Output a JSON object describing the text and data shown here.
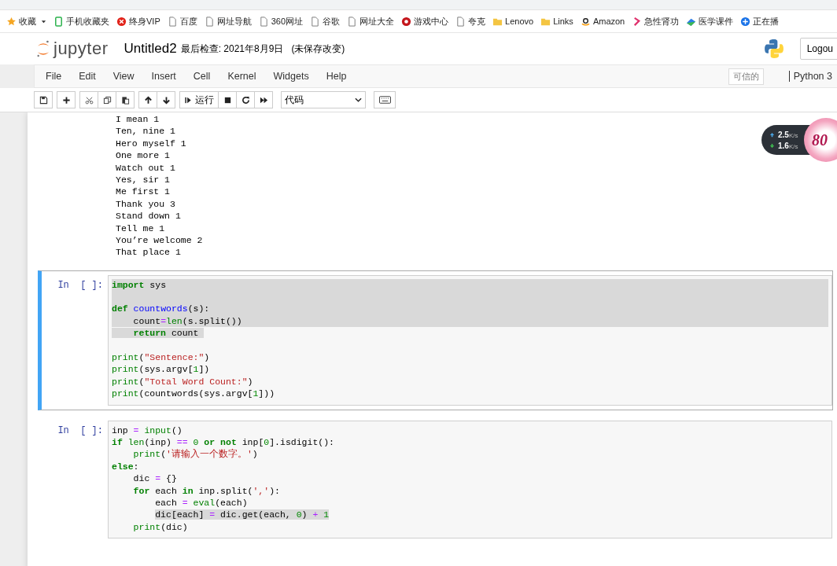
{
  "bookmarks": [
    {
      "kind": "star",
      "label": "收藏",
      "caret": true
    },
    {
      "kind": "phone",
      "label": "手机收藏夹"
    },
    {
      "kind": "vip",
      "label": "终身VIP"
    },
    {
      "kind": "doc",
      "label": "百度"
    },
    {
      "kind": "doc",
      "label": "网址导航"
    },
    {
      "kind": "doc",
      "label": "360网址"
    },
    {
      "kind": "doc",
      "label": "谷歌"
    },
    {
      "kind": "doc",
      "label": "网址大全"
    },
    {
      "kind": "game",
      "label": "游戏中心"
    },
    {
      "kind": "doc",
      "label": "夸克"
    },
    {
      "kind": "folder",
      "label": "Lenovo"
    },
    {
      "kind": "folder",
      "label": "Links"
    },
    {
      "kind": "amazon",
      "label": "Amazon"
    },
    {
      "kind": "ribbon",
      "label": "急性肾功"
    },
    {
      "kind": "book",
      "label": "医学课件"
    },
    {
      "kind": "plus",
      "label": "正在播"
    }
  ],
  "header": {
    "logo": "jupyter",
    "title": "Untitled2",
    "checkpoint": "最后检查: 2021年8月9日",
    "unsaved": "(未保存改变)",
    "logout": "Logou"
  },
  "menu": {
    "items": [
      "File",
      "Edit",
      "View",
      "Insert",
      "Cell",
      "Kernel",
      "Widgets",
      "Help"
    ],
    "trusted": "可信的",
    "kernel": "Python 3"
  },
  "toolbar": {
    "buttons": [
      {
        "kind": "save"
      },
      {
        "kind": "plus"
      },
      {
        "kind": "cut"
      },
      {
        "kind": "copy"
      },
      {
        "kind": "paste"
      },
      {
        "kind": "up"
      },
      {
        "kind": "down"
      },
      {
        "kind": "run",
        "label": "运行"
      },
      {
        "kind": "stop"
      },
      {
        "kind": "restart"
      },
      {
        "kind": "forward"
      }
    ],
    "cell_type": "代码"
  },
  "output": [
    "I mean 1",
    "Ten, nine 1",
    "Hero myself 1",
    "One more 1",
    "Watch out 1",
    "Yes, sir 1",
    "Me first 1",
    "Thank you 3",
    "Stand down 1",
    "Tell me 1",
    "You’re welcome 2",
    "That place 1"
  ],
  "cells": [
    {
      "prompt": "In  [ ]:",
      "selected": true,
      "lines": [
        {
          "kind": "code",
          "selected": true,
          "tokens": [
            {
              "kind": "kw",
              "text": "import"
            },
            {
              "kind": "p",
              "text": " sys"
            }
          ]
        },
        {
          "kind": "blank",
          "selected": true
        },
        {
          "kind": "code",
          "selected": true,
          "tokens": [
            {
              "kind": "kw",
              "text": "def"
            },
            {
              "kind": "fn",
              "text": " countwords"
            },
            {
              "kind": "p",
              "text": "(s):"
            }
          ]
        },
        {
          "kind": "code",
          "selected": true,
          "tokens": [
            {
              "kind": "p",
              "text": "    count"
            },
            {
              "kind": "op",
              "text": "="
            },
            {
              "kind": "bi",
              "text": "len"
            },
            {
              "kind": "p",
              "text": "(s.split())"
            }
          ]
        },
        {
          "kind": "code-mark",
          "selected": false,
          "tokens": [
            {
              "kind": "kw",
              "text": "    return"
            },
            {
              "kind": "p",
              "text": " count "
            }
          ]
        },
        {
          "kind": "blank",
          "selected": false
        },
        {
          "kind": "code",
          "selected": false,
          "tokens": [
            {
              "kind": "bi",
              "text": "print"
            },
            {
              "kind": "p",
              "text": "("
            },
            {
              "kind": "str",
              "text": "\"Sentence:\""
            },
            {
              "kind": "p",
              "text": ")"
            }
          ]
        },
        {
          "kind": "code",
          "selected": false,
          "tokens": [
            {
              "kind": "bi",
              "text": "print"
            },
            {
              "kind": "p",
              "text": "(sys.argv["
            },
            {
              "kind": "num",
              "text": "1"
            },
            {
              "kind": "p",
              "text": "])"
            }
          ]
        },
        {
          "kind": "code",
          "selected": false,
          "tokens": [
            {
              "kind": "bi",
              "text": "print"
            },
            {
              "kind": "p",
              "text": "("
            },
            {
              "kind": "str",
              "text": "\"Total Word Count:\""
            },
            {
              "kind": "p",
              "text": ")"
            }
          ]
        },
        {
          "kind": "code",
          "selected": false,
          "tokens": [
            {
              "kind": "bi",
              "text": "print"
            },
            {
              "kind": "p",
              "text": "(countwords(sys.argv["
            },
            {
              "kind": "num",
              "text": "1"
            },
            {
              "kind": "p",
              "text": "]))"
            }
          ]
        }
      ]
    },
    {
      "prompt": "In  [ ]:",
      "selected": false,
      "lines": [
        {
          "kind": "code",
          "selected": false,
          "tokens": [
            {
              "kind": "p",
              "text": "inp "
            },
            {
              "kind": "op",
              "text": "="
            },
            {
              "kind": "bi",
              "text": " input"
            },
            {
              "kind": "p",
              "text": "()"
            }
          ]
        },
        {
          "kind": "code",
          "selected": false,
          "tokens": [
            {
              "kind": "kw",
              "text": "if"
            },
            {
              "kind": "bi",
              "text": " len"
            },
            {
              "kind": "p",
              "text": "(inp) "
            },
            {
              "kind": "op",
              "text": "=="
            },
            {
              "kind": "num",
              "text": " 0"
            },
            {
              "kind": "kw",
              "text": " or not"
            },
            {
              "kind": "p",
              "text": " inp["
            },
            {
              "kind": "num",
              "text": "0"
            },
            {
              "kind": "p",
              "text": "].isdigit():"
            }
          ]
        },
        {
          "kind": "code",
          "selected": false,
          "tokens": [
            {
              "kind": "bi",
              "text": "    print"
            },
            {
              "kind": "p",
              "text": "("
            },
            {
              "kind": "str",
              "text": "'请输入一个数字。'"
            },
            {
              "kind": "p",
              "text": ")"
            }
          ]
        },
        {
          "kind": "code",
          "selected": false,
          "tokens": [
            {
              "kind": "kw",
              "text": "else"
            },
            {
              "kind": "p",
              "text": ":"
            }
          ]
        },
        {
          "kind": "code",
          "selected": false,
          "tokens": [
            {
              "kind": "p",
              "text": "    dic "
            },
            {
              "kind": "op",
              "text": "="
            },
            {
              "kind": "p",
              "text": " {}"
            }
          ]
        },
        {
          "kind": "code",
          "selected": false,
          "tokens": [
            {
              "kind": "kw",
              "text": "    for"
            },
            {
              "kind": "p",
              "text": " each "
            },
            {
              "kind": "kw",
              "text": "in"
            },
            {
              "kind": "p",
              "text": " inp.split("
            },
            {
              "kind": "str",
              "text": "','"
            },
            {
              "kind": "p",
              "text": "):"
            }
          ]
        },
        {
          "kind": "code",
          "selected": false,
          "tokens": [
            {
              "kind": "p",
              "text": "        each "
            },
            {
              "kind": "op",
              "text": "="
            },
            {
              "kind": "bi",
              "text": " eval"
            },
            {
              "kind": "p",
              "text": "(each)"
            }
          ]
        },
        {
          "kind": "code-mark-deep",
          "selected": false,
          "tokens": [
            {
              "kind": "p",
              "text": "dic[each] "
            },
            {
              "kind": "op",
              "text": "="
            },
            {
              "kind": "p",
              "text": " dic.get(each, "
            },
            {
              "kind": "num",
              "text": "0"
            },
            {
              "kind": "p",
              "text": ") "
            },
            {
              "kind": "op",
              "text": "+"
            },
            {
              "kind": "num",
              "text": " 1"
            }
          ]
        },
        {
          "kind": "code",
          "selected": false,
          "tokens": [
            {
              "kind": "bi",
              "text": "    print"
            },
            {
              "kind": "p",
              "text": "(dic)"
            }
          ]
        }
      ]
    }
  ],
  "net": {
    "up": "2.5",
    "up_unit": "K/s",
    "down": "1.6",
    "down_unit": "K/s",
    "badge": "80"
  }
}
